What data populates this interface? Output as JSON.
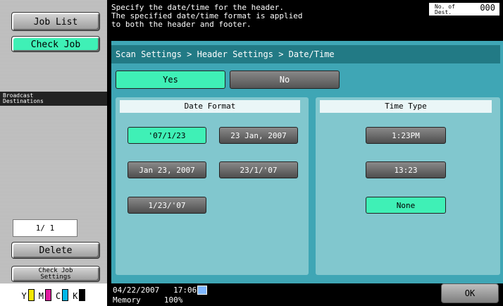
{
  "left_panel": {
    "job_list": "Job List",
    "check_job": "Check Job",
    "broadcast_destinations": "Broadcast\nDestinations",
    "pager": "1/ 1",
    "delete": "Delete",
    "check_job_settings": "Check Job\nSettings",
    "toner": [
      {
        "label": "Y",
        "color": "#f3e700"
      },
      {
        "label": "M",
        "color": "#e01aa0"
      },
      {
        "label": "C",
        "color": "#00b7e8"
      },
      {
        "label": "K",
        "color": "#000000"
      }
    ]
  },
  "header": {
    "message": "Specify the date/time for the header.\nThe specified date/time format is applied\nto both the header and footer.",
    "destinations_label": "No. of\nDest.",
    "destinations_count": "000"
  },
  "main": {
    "breadcrumb": "Scan Settings > Header Settings > Date/Time",
    "yes": "Yes",
    "no": "No",
    "date_format": {
      "title": "Date Format",
      "options": [
        "'07/1/23",
        "23 Jan, 2007",
        "Jan 23, 2007",
        "23/1/'07",
        "1/23/'07"
      ],
      "selected": "'07/1/23"
    },
    "time_type": {
      "title": "Time Type",
      "options": [
        "1:23PM",
        "13:23",
        "None"
      ],
      "selected": "None"
    }
  },
  "status": {
    "date": "04/22/2007",
    "time": "17:06",
    "memory_label": "Memory",
    "memory_value": "100%",
    "ok": "OK"
  },
  "colors": {
    "selected": "#3ff0b6",
    "panel": "#3fa6b5",
    "breadcrumb": "#227a85"
  }
}
